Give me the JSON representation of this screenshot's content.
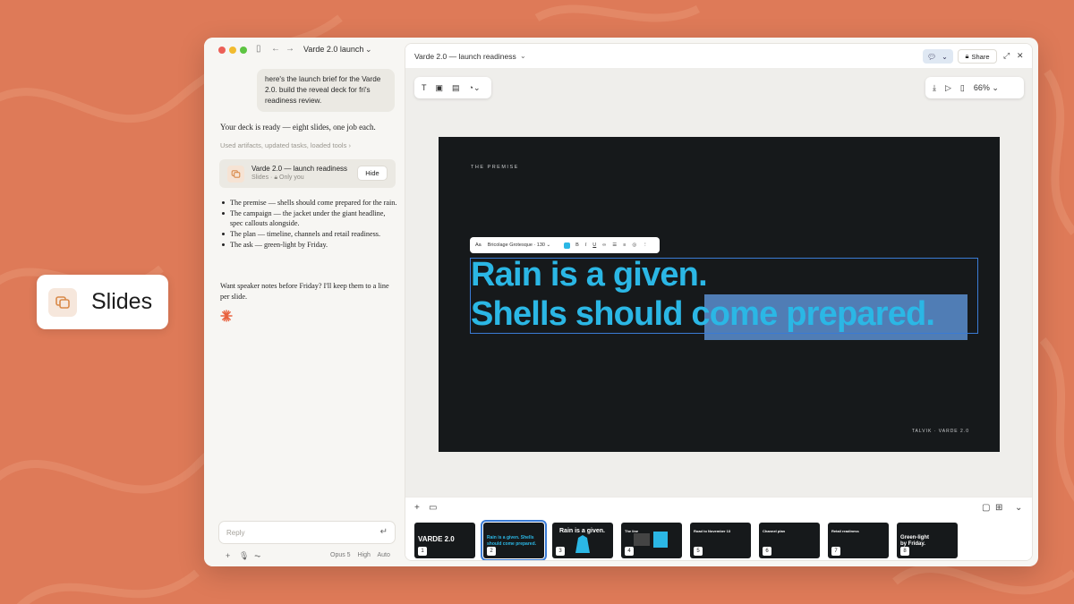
{
  "badge": {
    "label": "Slides"
  },
  "chat": {
    "window_title": "Varde 2.0 launch",
    "user_message": "here's the launch brief for the Varde 2.0. build the reveal deck for fri's readiness review.",
    "assistant_reply": "Your deck is ready — eight slides, one job each.",
    "used_line": "Used artifacts, updated tasks, loaded tools",
    "artifact": {
      "title": "Varde 2.0 — launch readiness",
      "type": "Slides",
      "visibility": "Only you",
      "hide_label": "Hide"
    },
    "bullets": [
      "The premise — shells should come prepared for the rain.",
      "The campaign — the jacket under the giant headline, spec callouts alongside.",
      "The plan — timeline, channels and retail readiness.",
      "The ask — green-light by Friday."
    ],
    "notes": "Want speaker notes before Friday? I'll keep them to a line per slide.",
    "reply_placeholder": "Reply",
    "model": "Opus 5",
    "effort": "High",
    "mode": "Auto"
  },
  "editor": {
    "doc_title": "Varde 2.0 — launch readiness",
    "share_label": "Share",
    "zoom": "66%",
    "slide": {
      "kicker": "THE PREMISE",
      "headline_line1": "Rain is a given.",
      "headline_line2": "Shells should come prepared.",
      "footer": "TALVIK · VARDE 2.0",
      "format_font": "Bricolage Grotesque · 130"
    },
    "thumbnails": [
      {
        "num": "1",
        "text": "VARDE 2.0"
      },
      {
        "num": "2",
        "text": "Rain is a given. Shells should come prepared."
      },
      {
        "num": "3",
        "text": "Rain is a given."
      },
      {
        "num": "4",
        "text": "The line"
      },
      {
        "num": "5",
        "text": "Road to November 13"
      },
      {
        "num": "6",
        "text": "Channel plan"
      },
      {
        "num": "7",
        "text": "Retail readiness"
      },
      {
        "num": "8",
        "text": "Green-light by Friday."
      }
    ]
  },
  "colors": {
    "background": "#de7a58",
    "accent_cyan": "#2bb7e5",
    "selection_blue": "#3a7bd5",
    "slide_dark": "#16191b",
    "spark": "#e8623f"
  }
}
